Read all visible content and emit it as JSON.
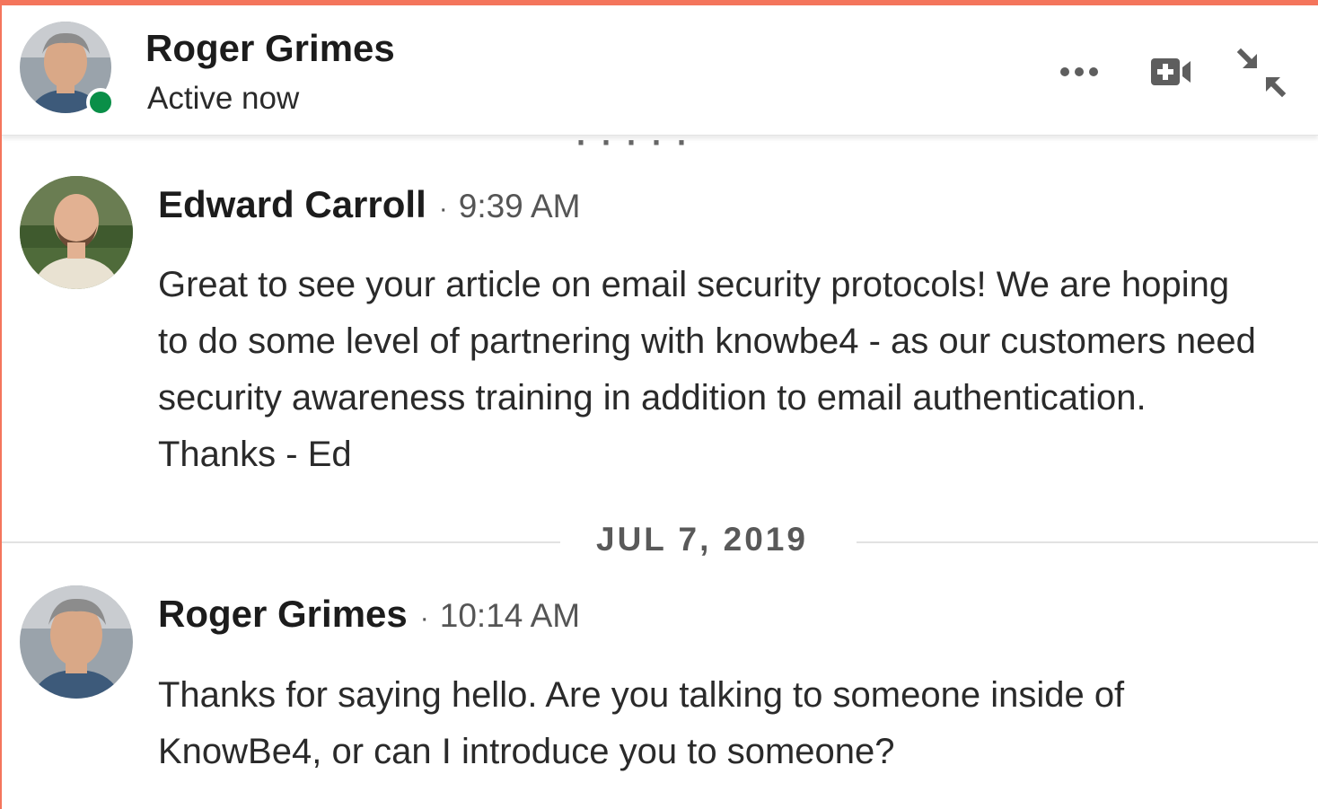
{
  "header": {
    "name": "Roger Grimes",
    "status": "Active now",
    "more_icon": "more-horizontal-icon",
    "video_icon": "video-call-icon",
    "minimize_icon": "minimize-arrows-icon",
    "presence_color": "#0a8f48"
  },
  "accent_color": "#f4755c",
  "messages": [
    {
      "sender": "Edward Carroll",
      "separator": "·",
      "time": "9:39 AM",
      "text": "Great to see your article on email security protocols! We are hoping to do some level of partnering with knowbe4 - as our customers need security awareness training in addition to email authentication. Thanks - Ed"
    },
    {
      "sender": "Roger Grimes",
      "separator": "·",
      "time": "10:14 AM",
      "text": "Thanks for saying hello. Are you talking to someone inside of KnowBe4, or can I introduce you to someone?"
    }
  ],
  "date_divider": "JUL 7, 2019"
}
